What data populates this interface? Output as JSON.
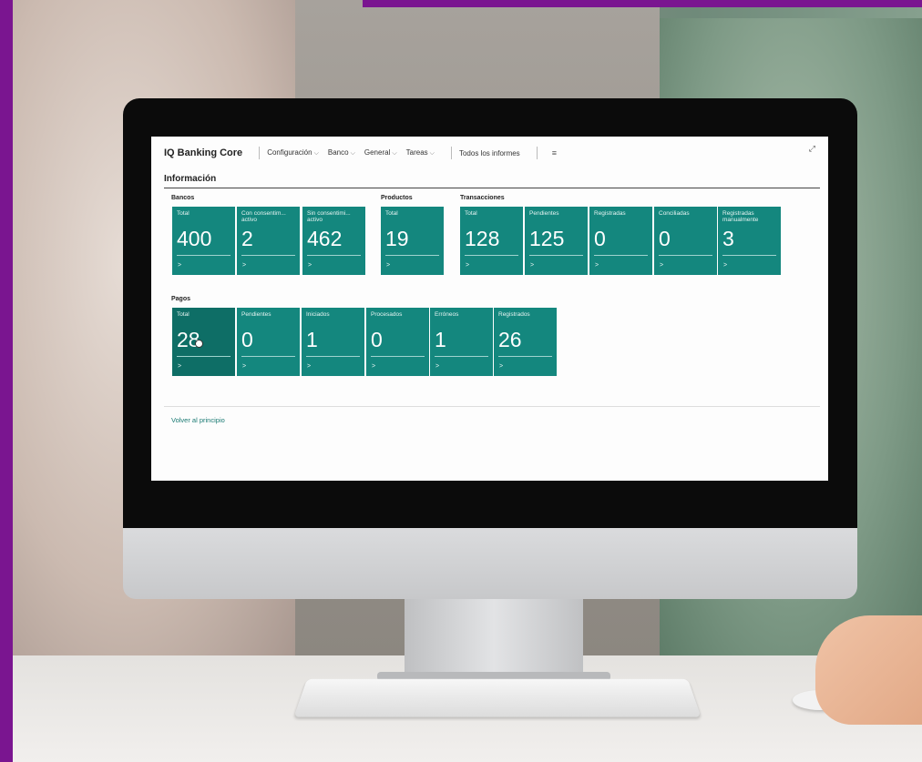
{
  "app_title": "IQ Banking Core",
  "nav": {
    "items": [
      {
        "label": "Configuración",
        "chevron": "⌵"
      },
      {
        "label": "Banco",
        "chevron": "⌵"
      },
      {
        "label": "General",
        "chevron": "⌵"
      },
      {
        "label": "Tareas",
        "chevron": "⌵"
      }
    ],
    "reports": "Todos los informes",
    "menu_icon": "≡",
    "expand_icon": "⤢"
  },
  "page_title": "Información",
  "groups": {
    "bancos": {
      "label": "Bancos",
      "tiles": [
        {
          "label": "Total",
          "value": "400"
        },
        {
          "label": "Con consentim... activo",
          "value": "2"
        },
        {
          "label": "Sin consentimi... activo",
          "value": "462"
        }
      ]
    },
    "productos": {
      "label": "Productos",
      "tiles": [
        {
          "label": "Total",
          "value": "19"
        }
      ]
    },
    "transacciones": {
      "label": "Transacciones",
      "tiles": [
        {
          "label": "Total",
          "value": "128"
        },
        {
          "label": "Pendientes",
          "value": "125"
        },
        {
          "label": "Registradas",
          "value": "0"
        },
        {
          "label": "Conciliadas",
          "value": "0"
        },
        {
          "label": "Registradas manualmente",
          "value": "3"
        }
      ]
    },
    "pagos": {
      "label": "Pagos",
      "tiles": [
        {
          "label": "Total",
          "value": "28"
        },
        {
          "label": "Pendientes",
          "value": "0"
        },
        {
          "label": "Iniciados",
          "value": "1"
        },
        {
          "label": "Procesados",
          "value": "0"
        },
        {
          "label": "Erróneos",
          "value": "1"
        },
        {
          "label": "Registrados",
          "value": "26"
        }
      ]
    }
  },
  "tile_arrow": ">",
  "back_link": "Volver al principio",
  "colors": {
    "tile": "#14877e",
    "tile_selected": "#0e6e66",
    "frame": "#7a1590"
  }
}
